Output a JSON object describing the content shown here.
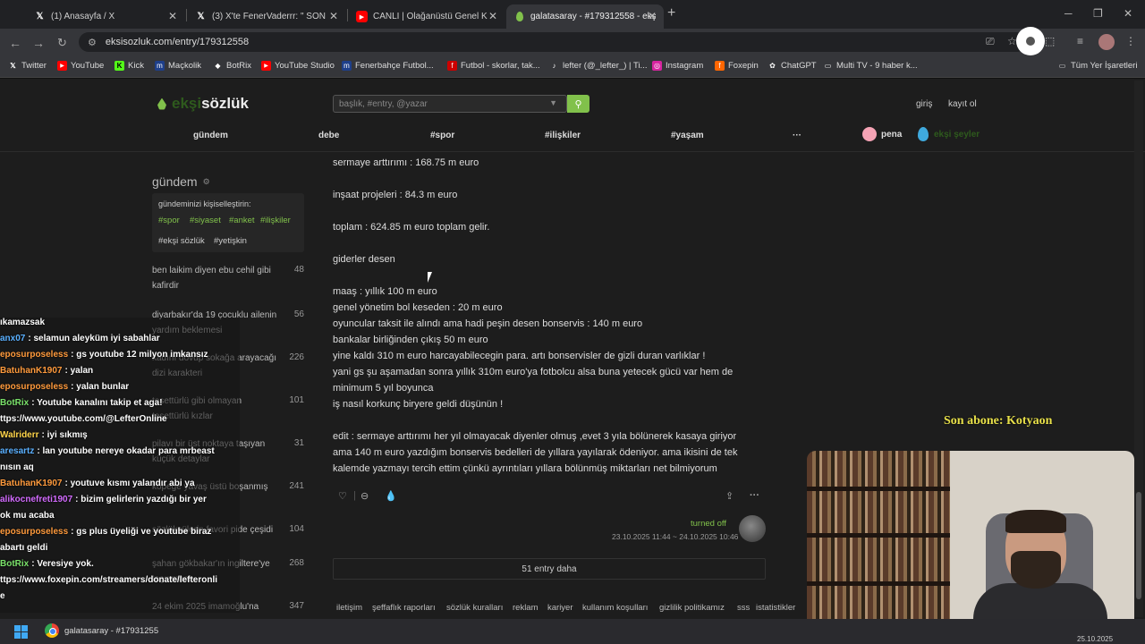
{
  "browser": {
    "tabs": [
      {
        "icon": "x-logo",
        "title": "(1) Anasayfa / X"
      },
      {
        "icon": "x-logo",
        "title": "(3) X'te FenerVaderrr: \" SON"
      },
      {
        "icon": "youtube",
        "title": "CANLI | Olağanüstü Genel K"
      },
      {
        "icon": "eksi",
        "title": "galatasaray - #179312558 - ekş"
      }
    ],
    "new_tab": "+",
    "url": "eksisozluk.com/entry/179312558",
    "bookmarks": [
      {
        "label": "Twitter",
        "icon": "x"
      },
      {
        "label": "YouTube",
        "icon": "yt"
      },
      {
        "label": "Kick",
        "icon": "k"
      },
      {
        "label": "Maçkolik",
        "icon": "m"
      },
      {
        "label": "BotRix",
        "icon": "b"
      },
      {
        "label": "YouTube Studio",
        "icon": "yt"
      },
      {
        "label": "Fenerbahçe Futbol...",
        "icon": "m"
      },
      {
        "label": "Futbol - skorlar, tak...",
        "icon": "f"
      },
      {
        "label": "lefter (@_lefter_) | Ti...",
        "icon": "tt"
      },
      {
        "label": "Instagram",
        "icon": "ig"
      },
      {
        "label": "Foxepin",
        "icon": "fx"
      },
      {
        "label": "ChatGPT",
        "icon": "gpt"
      },
      {
        "label": "Multi TV - 9 haber k...",
        "icon": "tv"
      }
    ],
    "all_bookmarks": "Tüm Yer İşaretleri"
  },
  "site": {
    "logo_prefix": "ekşi",
    "logo_suffix": "sözlük",
    "search_placeholder": "başlık, #entry, @yazar",
    "login": "giriş",
    "register": "kayıt ol",
    "nav": [
      "gündem",
      "debe",
      "#spor",
      "#ilişkiler",
      "#yaşam",
      "···"
    ],
    "pena": "pena",
    "eksi_seyler": "ekşi şeyler"
  },
  "sidebar": {
    "title": "gündem",
    "personalize_label": "gündeminizi kişiselleştirin:",
    "tags": [
      "#spor",
      "#siyaset",
      "#anket",
      "#ilişkiler"
    ],
    "tags2": [
      "#ekşi sözlük",
      "#yetişkin"
    ],
    "items": [
      {
        "text": "ben laikim diyen ebu cehil gibi kafirdir",
        "count": "48"
      },
      {
        "text": "diyarbakır'da 19 çocuklu ailenin yardım beklemesi",
        "count": "56"
      },
      {
        "text": "kadını dövüp sokağa arayacağı dizi karakteri",
        "count": "226"
      },
      {
        "text": "tesettürlü gibi olmayan tesettürlü kızlar",
        "count": "101"
      },
      {
        "text": "pilavı bir üst noktaya taşıyan küçük detaylar",
        "count": "31"
      },
      {
        "text": "köpeğe yavaş üstü boşanmış",
        "count": "241"
      },
      {
        "text": "sözlükçülerin favori pide çeşidi",
        "count": "104"
      },
      {
        "text": "şahan gökbakar'ın ingiltere'ye taşınması",
        "count": "268"
      },
      {
        "text": "24 ekim 2025 imamoğlu'na",
        "count": "347"
      }
    ]
  },
  "entry": {
    "lines": [
      "sermaye arttırımı : 168.75 m euro",
      "inşaat projeleri : 84.3 m euro",
      "toplam : 624.85 m euro toplam gelir.",
      "giderler desen",
      "maaş : yıllık 100 m euro",
      "genel yönetim bol keseden : 20 m euro",
      "oyuncular taksit ile alındı ama hadi peşin desen bonservis : 140 m euro",
      "bankalar birliğinden çıkış 50 m euro",
      "yine kaldı 310 m euro harcayabilecegin para. artı bonservisler de gizli duran varlıklar !",
      "yani gs şu aşamadan sonra yıllık 310m euro'ya fotbolcu alsa buna yetecek gücü var hem de",
      "minimum 5 yıl boyunca",
      "iş nasıl korkunç biryere geldi düşünün !",
      "edit : sermaye arttırımı her yıl olmayacak diyenler olmuş ,evet 3 yıla bölünerek kasaya giriyor",
      "ama 140 m euro yazdığım bonservis bedelleri de yıllara yayılarak ödeniyor. ama ikisini de tek",
      "kalemde yazmayı tercih ettim çünkü ayrıntıları yıllara bölünmüş miktarları net bilmiyorum"
    ],
    "author": "turned off",
    "date": "23.10.2025 11:44 ~ 24.10.2025 10:46",
    "more": "51 entry daha"
  },
  "footer": [
    "iletişim",
    "şeffaflık raporları",
    "sözlük kuralları",
    "reklam",
    "kariyer",
    "kullanım koşulları",
    "gizlilik politikamız",
    "sss",
    "istatistikler"
  ],
  "chat": [
    {
      "user": "",
      "msg": "ıkamazsak",
      "color": "#fff"
    },
    {
      "user": "anx07",
      "msg": ": selamun aleyküm iyi sabahlar",
      "color": "#5ab0ff"
    },
    {
      "user": "eposurposeless",
      "msg": ": gs youtube 12 milyon imkansız",
      "color": "#ff9a3c"
    },
    {
      "user": "BatuhanK1907",
      "msg": ": yalan",
      "color": "#ff9a3c"
    },
    {
      "user": "eposurposeless",
      "msg": ": yalan bunlar",
      "color": "#ff9a3c"
    },
    {
      "user": "BotRix",
      "msg": ": Youtube kanalını takip et aga!",
      "color": "#7be36b"
    },
    {
      "user": "",
      "msg": "ttps://www.youtube.com/@LefterOnline",
      "color": "#fff"
    },
    {
      "user": "Walriderr",
      "msg": ": iyi sıkmış",
      "color": "#ffd54a"
    },
    {
      "user": "aresartz",
      "msg": ": lan youtube nereye okadar para mrbeast",
      "color": "#5ab0ff"
    },
    {
      "user": "",
      "msg": "nısın aq",
      "color": "#fff"
    },
    {
      "user": "BatuhanK1907",
      "msg": ": youtuve kısmı yalandır abi ya",
      "color": "#ff9a3c"
    },
    {
      "user": "alikocnefreti1907",
      "msg": ": bizim gelirlerin yazdığı bir yer",
      "color": "#d36bff"
    },
    {
      "user": "",
      "msg": "ok mu acaba",
      "color": "#fff"
    },
    {
      "user": "eposurposeless",
      "msg": ": gs plus üyeliği ve youtube biraz",
      "color": "#ff9a3c"
    },
    {
      "user": "",
      "msg": "abartı geldi",
      "color": "#fff"
    },
    {
      "user": "BotRix",
      "msg": ": Veresiye yok.",
      "color": "#7be36b"
    },
    {
      "user": "",
      "msg": "ttps://www.foxepin.com/streamers/donate/lefteronli",
      "color": "#fff"
    },
    {
      "user": "",
      "msg": "e",
      "color": "#fff"
    }
  ],
  "subscriber": "Son abone: Kotyaon",
  "taskbar": {
    "app_title": "galatasaray - #17931255",
    "clock": "25.10.2025"
  },
  "colors": {
    "accent": "#81c14b",
    "bg": "#1d1d1d"
  }
}
